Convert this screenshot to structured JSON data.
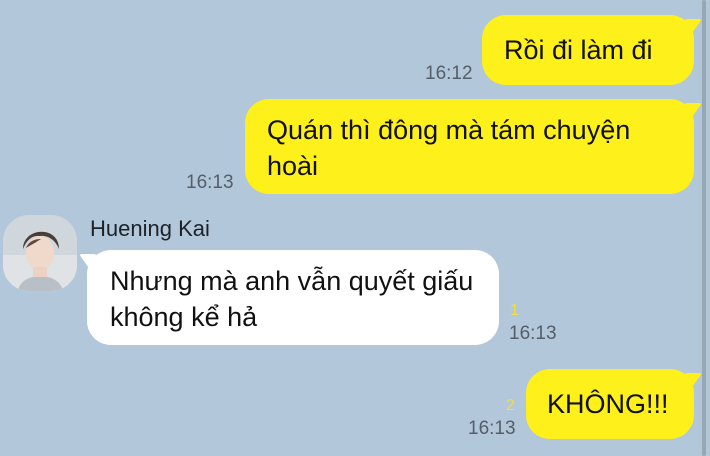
{
  "chat": {
    "messages": [
      {
        "sender": "me",
        "text": "Rồi đi làm đi",
        "time": "16:12",
        "unread": ""
      },
      {
        "sender": "me",
        "text": "Quán thì đông mà tám chuyện hoài",
        "time": "16:13",
        "unread": ""
      },
      {
        "sender": "Huening Kai",
        "name": "Huening Kai",
        "text": "Nhưng mà anh vẫn quyết giấu không kể hả",
        "time": "16:13",
        "unread": "1"
      },
      {
        "sender": "me",
        "text": "KHÔNG!!!",
        "time": "16:13",
        "unread": "2"
      }
    ],
    "avatar_icon": "profile-photo-avatar"
  },
  "colors": {
    "background": "#b2c7da",
    "my_bubble": "#fef01b",
    "their_bubble": "#ffffff",
    "unread_count": "#f5dd3c"
  }
}
